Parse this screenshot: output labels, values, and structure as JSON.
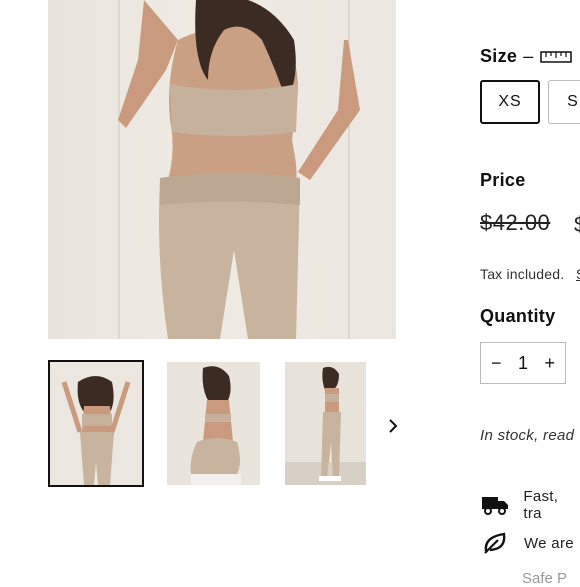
{
  "product": {
    "main_image_alt": "Beige bandeau bra and high-waisted leggings set",
    "thumbnails": [
      {
        "alt": "Front view",
        "selected": true
      },
      {
        "alt": "Back view",
        "selected": false
      },
      {
        "alt": "Side view",
        "selected": false
      }
    ]
  },
  "size": {
    "label": "Size",
    "dash": "–",
    "guide_icon": "ruler-icon",
    "options": [
      "XS",
      "S"
    ],
    "selected": "XS"
  },
  "price": {
    "label": "Price",
    "original": "$42.00",
    "sale_fragment": "$",
    "tax_note": "Tax included.",
    "tax_link_fragment": "S"
  },
  "quantity": {
    "label": "Quantity",
    "value": "1",
    "minus": "−",
    "plus": "+"
  },
  "stock_text": "In stock, read",
  "features": [
    {
      "icon": "truck-icon",
      "text": "Fast, tra"
    },
    {
      "icon": "leaf-icon",
      "text": "We are"
    }
  ],
  "bottom_fragment": "Safe P",
  "colors": {
    "border_dark": "#111111",
    "border_light": "#bbbbbb",
    "image_bg": "#ece7e0"
  }
}
